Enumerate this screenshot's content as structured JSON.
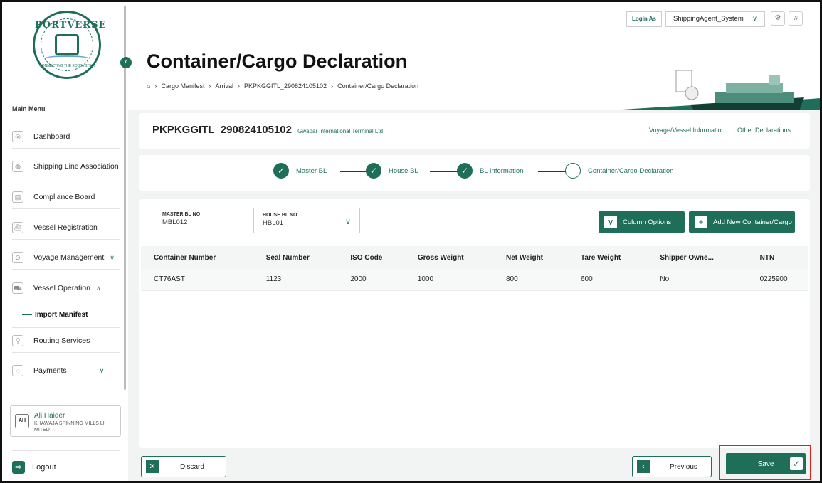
{
  "logo": {
    "word": "PORTVERSE",
    "tagline": "CONNECTING THE ECOSYSTEM"
  },
  "sidebar": {
    "menu_title": "Main Menu",
    "items": [
      {
        "label": "Dashboard"
      },
      {
        "label": "Shipping Line Association"
      },
      {
        "label": "Compliance Board"
      },
      {
        "label": "Vessel Registration"
      },
      {
        "label": "Voyage Management"
      },
      {
        "label": "Vessel Operation"
      },
      {
        "label": "Routing Services"
      },
      {
        "label": "Payments"
      }
    ],
    "sub_item": "Import Manifest",
    "user": {
      "initials": "AH",
      "name": "Ali Haider",
      "company": "KHAWAJA SPINNING MILLS LI MITED"
    },
    "logout": "Logout"
  },
  "topbar": {
    "login_as": "Login As",
    "user_select": "ShippingAgent_System"
  },
  "header": {
    "title": "Container/Cargo Declaration",
    "breadcrumb": [
      "Cargo Manifest",
      "Arrival",
      "PKPKGGITL_290824105102",
      "Container/Cargo Declaration"
    ]
  },
  "declaration": {
    "id": "PKPKGGITL_290824105102",
    "org": "Gwadar International Terminal Ltd",
    "link_voyage": "Voyage/Vessel Information",
    "link_other": "Other Declarations"
  },
  "steps": [
    {
      "label": "Master BL",
      "done": true
    },
    {
      "label": "House BL",
      "done": true
    },
    {
      "label": "BL Information",
      "done": true
    },
    {
      "label": "Container/Cargo Declaration",
      "done": false
    }
  ],
  "bl": {
    "master_label": "MASTER BL NO",
    "master_value": "MBL012",
    "house_label": "HOUSE BL NO",
    "house_value": "HBL01"
  },
  "actions": {
    "column_options": "Column Options",
    "add_new": "Add New Container/Cargo"
  },
  "table": {
    "headers": [
      "Container Number",
      "Seal Number",
      "ISO Code",
      "Gross Weight",
      "Net Weight",
      "Tare Weight",
      "Shipper Owne...",
      "NTN"
    ],
    "rows": [
      [
        "CT76AST",
        "1123",
        "2000",
        "1000",
        "800",
        "600",
        "No",
        "0225900"
      ]
    ]
  },
  "footer": {
    "discard": "Discard",
    "previous": "Previous",
    "save": "Save"
  },
  "colors": {
    "brand": "#1e6e5a",
    "highlight": "#e0201c"
  }
}
